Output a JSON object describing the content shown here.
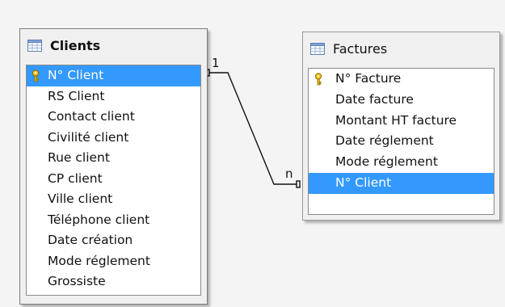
{
  "tables": {
    "clients": {
      "title": "Clients",
      "key_field": "N° Client",
      "fields": [
        "RS Client",
        "Contact client",
        "Civilité client",
        "Rue client",
        "CP client",
        "Ville client",
        "Téléphone client",
        "Date création",
        "Mode réglement",
        "Grossiste"
      ]
    },
    "factures": {
      "title": "Factures",
      "key_field": "N° Facture",
      "fields": [
        "Date facture",
        "Montant HT facture",
        "Date réglement",
        "Mode réglement"
      ],
      "selected_field": "N° Client"
    }
  },
  "relationship": {
    "from_cardinality": "1",
    "to_cardinality": "n"
  },
  "colors": {
    "selection": "#3399ff",
    "key_icon": "#d9a400"
  },
  "icons": {
    "table": "table-grid-icon",
    "primary_key": "key-icon"
  }
}
